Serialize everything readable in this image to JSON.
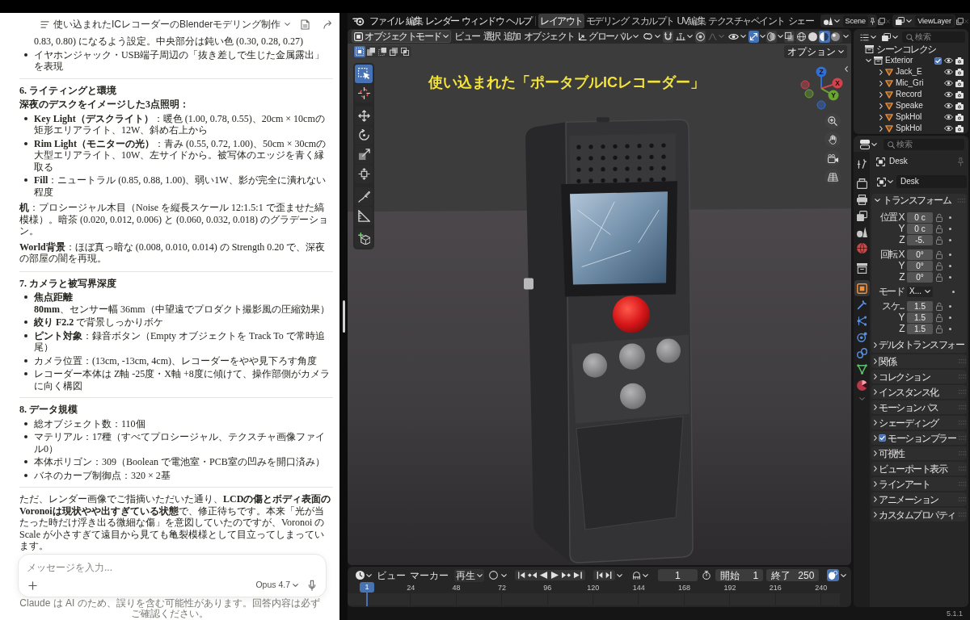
{
  "chat": {
    "title": "使い込まれたICレコーダーのBlenderモデリング制作",
    "blocks": [
      {
        "kind": "fragment",
        "text": "0.83, 0.80) になるよう設定。中央部分は鈍い色 (0.30, 0.28, 0.27)"
      },
      {
        "kind": "list",
        "items": [
          "イヤホンジャック・USB端子周辺の「抜き差しで生じた金属露出」を表現"
        ]
      },
      {
        "kind": "rule"
      },
      {
        "kind": "heading",
        "text": "6. ライティングと環境"
      },
      {
        "kind": "lead",
        "text": "深夜のデスクをイメージした3点照明："
      },
      {
        "kind": "list",
        "items": [
          "**Key Light（デスクライト）**：暖色 (1.00, 0.78, 0.55)、20cm × 10cmの矩形エリアライト、12W、斜め右上から",
          "**Rim Light（モニターの光）**：青み (0.55, 0.72, 1.00)、50cm × 30cmの大型エリアライト、10W、左サイドから。被写体のエッジを青く縁取る",
          "**Fill**：ニュートラル (0.85, 0.88, 1.00)、弱い1W、影が完全に潰れない程度"
        ]
      },
      {
        "kind": "paragraph",
        "text": "**机**：プロシージャル木目（Noise を縦長スケール 12:1.5:1 で歪ませた縞模様）。暗茶 (0.020, 0.012, 0.006) と (0.060, 0.032, 0.018) のグラデーション。"
      },
      {
        "kind": "paragraph",
        "text": "**World背景**：ほぼ真っ暗な (0.008, 0.010, 0.014) の Strength 0.20 で、深夜の部屋の闇を再現。"
      },
      {
        "kind": "rule"
      },
      {
        "kind": "heading",
        "text": "7. カメラと被写界深度"
      },
      {
        "kind": "list",
        "items": [
          "**焦点距離**\n**80mm**、センサー幅 36mm（中望遠でプロダクト撮影風の圧縮効果）",
          "**絞り F2.2** で背景しっかりボケ",
          "**ピント対象**：録音ボタン（Empty オブジェクトを Track To で常時追尾）",
          "カメラ位置：(13cm, -13cm, 4cm)、レコーダーをやや見下ろす角度",
          "レコーダー本体は Z軸 -25度・X軸 +8度に傾けて、操作部側がカメラに向く構図"
        ]
      },
      {
        "kind": "rule"
      },
      {
        "kind": "heading",
        "text": "8. データ規模"
      },
      {
        "kind": "list",
        "items": [
          "総オブジェクト数：110個",
          "マテリアル：17種（すべてプロシージャル、テクスチャ画像ファイル0）",
          "本体ポリゴン：309（Boolean で電池室・PCB室の凹みを開口済み）",
          "バネのカーブ制御点：320 × 2基"
        ]
      },
      {
        "kind": "rule"
      },
      {
        "kind": "paragraph",
        "text": "ただ、レンダー画像でご指摘いただいた通り、**LCDの傷とボディ表面のVoronoiは現状やや出すぎている状態**で、修正待ちです。本来「光が当たった時だけ浮き出る微細な傷」を意図していたのですが、Voronoi の Scale が小さすぎて遠目から見ても亀裂模様として目立ってしまっています。"
      }
    ],
    "composer": {
      "placeholder": "メッセージを入力...",
      "model": "Opus 4.7"
    },
    "disclaimer": "Claude は AI のため、誤りを含む可能性があります。回答内容は必ずご確認ください。"
  },
  "blender": {
    "menus": [
      "ファイル",
      "編集",
      "レンダー",
      "ウィンドウ",
      "ヘルプ"
    ],
    "workspaces": [
      {
        "label": "レイアウト",
        "selected": true
      },
      {
        "label": "モデリング",
        "selected": false
      },
      {
        "label": "スカルプト",
        "selected": false
      },
      {
        "label": "UV編集",
        "selected": false
      },
      {
        "label": "テクスチャペイント",
        "selected": false
      },
      {
        "label": "シェー",
        "selected": false
      }
    ],
    "scene": "Scene",
    "view_layer": "ViewLayer",
    "viewport": {
      "mode": "オブジェクトモード",
      "menus": [
        "ビュー",
        "選択",
        "追加",
        "オブジェクト"
      ],
      "orientation": "グローバル",
      "toggles": [
        {
          "kind": "snap",
          "on": false
        },
        {
          "kind": "proportional",
          "on": false
        },
        {
          "kind": "gizmo",
          "on": true
        },
        {
          "kind": "overlay",
          "on": false
        },
        {
          "kind": "xray",
          "on": false
        }
      ],
      "shading": [
        {
          "kind": "wireframe",
          "selected": false
        },
        {
          "kind": "solid",
          "selected": false
        },
        {
          "kind": "material",
          "selected": true
        },
        {
          "kind": "rendered",
          "selected": false
        }
      ],
      "select_modes": [
        {
          "kind": "new",
          "selected": true
        },
        {
          "kind": "extend",
          "selected": false
        },
        {
          "kind": "subtract",
          "selected": false
        },
        {
          "kind": "invert",
          "selected": false
        },
        {
          "kind": "intersect",
          "selected": false
        }
      ],
      "options": "オプション",
      "tools": [
        [
          {
            "kind": "select-box",
            "selected": true
          },
          {
            "kind": "cursor",
            "selected": false
          }
        ],
        [
          {
            "kind": "move",
            "selected": false
          },
          {
            "kind": "rotate",
            "selected": false
          },
          {
            "kind": "scale",
            "selected": false
          },
          {
            "kind": "transform",
            "selected": false
          }
        ],
        [
          {
            "kind": "annotate",
            "selected": false
          },
          {
            "kind": "measure",
            "selected": false
          }
        ],
        [
          {
            "kind": "add-cube",
            "selected": false
          }
        ]
      ],
      "overlay_text": "使い込まれた「ポータブルICレコーダー」",
      "axes": [
        {
          "label": "Z",
          "color": "#2f6fd6"
        },
        {
          "label": "X",
          "color": "#d8404e"
        },
        {
          "label": "Y",
          "color": "#6aa532"
        }
      ]
    },
    "outliner": {
      "search_placeholder": "検索",
      "root": "シーンコレクシ",
      "collection": {
        "name": "Exterior",
        "expanded": true,
        "checked": true,
        "children": [
          {
            "name": "Jack_E",
            "expanded": false
          },
          {
            "name": "Mic_Gri",
            "expanded": false
          },
          {
            "name": "Record",
            "expanded": false
          },
          {
            "name": "Speake",
            "expanded": false
          },
          {
            "name": "SpkHol",
            "expanded": false
          },
          {
            "name": "SpkHol",
            "expanded": false
          }
        ]
      }
    },
    "properties": {
      "search_placeholder": "検索",
      "tabs": [
        [
          {
            "kind": "tool",
            "selected": false
          }
        ],
        [
          {
            "kind": "render",
            "selected": false
          },
          {
            "kind": "output",
            "selected": false
          },
          {
            "kind": "view-layer",
            "selected": false
          },
          {
            "kind": "scene",
            "selected": false
          },
          {
            "kind": "world",
            "selected": false
          }
        ],
        [
          {
            "kind": "collection",
            "selected": false
          }
        ],
        [
          {
            "kind": "object",
            "selected": true
          },
          {
            "kind": "modifiers",
            "selected": false
          },
          {
            "kind": "particles",
            "selected": false
          },
          {
            "kind": "physics",
            "selected": false
          },
          {
            "kind": "constraints",
            "selected": false
          },
          {
            "kind": "data",
            "selected": false
          },
          {
            "kind": "material",
            "selected": false
          }
        ]
      ],
      "object": "Desk",
      "data_block": "Desk",
      "transform": {
        "title": "トランスフォーム",
        "expanded": true,
        "groups": [
          [
            {
              "kind": "number",
              "label": "位置 X",
              "value": "0 c"
            },
            {
              "kind": "number",
              "label": "Y",
              "value": "0 c"
            },
            {
              "kind": "number",
              "label": "Z",
              "value": "-5."
            }
          ],
          [
            {
              "kind": "number",
              "label": "回転 X",
              "value": "0°"
            },
            {
              "kind": "number",
              "label": "Y",
              "value": "0°"
            },
            {
              "kind": "number",
              "label": "Z",
              "value": "0°"
            }
          ],
          [
            {
              "kind": "dropdown",
              "label": "モード",
              "value": "X..."
            }
          ],
          [
            {
              "kind": "number",
              "label": "スケ...",
              "value": "1.5"
            },
            {
              "kind": "number",
              "label": "Y",
              "value": "1.5"
            },
            {
              "kind": "number",
              "label": "Z",
              "value": "1.5"
            }
          ]
        ],
        "subpanel": {
          "title": "デルタトランスフォー",
          "expanded": false
        }
      },
      "panels": [
        {
          "kind": "plain",
          "label": "関係",
          "expanded": false
        },
        {
          "kind": "plain",
          "label": "コレクション",
          "expanded": false
        },
        {
          "kind": "plain",
          "label": "インスタンス化",
          "expanded": false
        },
        {
          "kind": "plain",
          "label": "モーションパス",
          "expanded": false
        },
        {
          "kind": "plain",
          "label": "シェーディング",
          "expanded": false
        },
        {
          "kind": "checkbox",
          "label": "モーションブラー",
          "expanded": false,
          "checked": true
        },
        {
          "kind": "plain",
          "label": "可視性",
          "expanded": false
        },
        {
          "kind": "plain",
          "label": "ビューポート表示",
          "expanded": false
        },
        {
          "kind": "plain",
          "label": "ラインアート",
          "expanded": false
        },
        {
          "kind": "plain",
          "label": "アニメーション",
          "expanded": false
        },
        {
          "kind": "plain",
          "label": "カスタムプロパティ",
          "expanded": false
        }
      ]
    },
    "timeline": {
      "menus": [
        "ビュー",
        "マーカー"
      ],
      "playback": "再生",
      "toggles": [
        {
          "kind": "record",
          "on": false
        },
        {
          "kind": "keying",
          "on": true
        }
      ],
      "current_frame": "1",
      "start_label": "開始",
      "start": "1",
      "end_label": "終了",
      "end": "250",
      "playhead": "1",
      "ticks": [
        "24",
        "48",
        "72",
        "96",
        "120",
        "144",
        "168",
        "192",
        "216",
        "240"
      ]
    },
    "version": "5.1.1"
  }
}
